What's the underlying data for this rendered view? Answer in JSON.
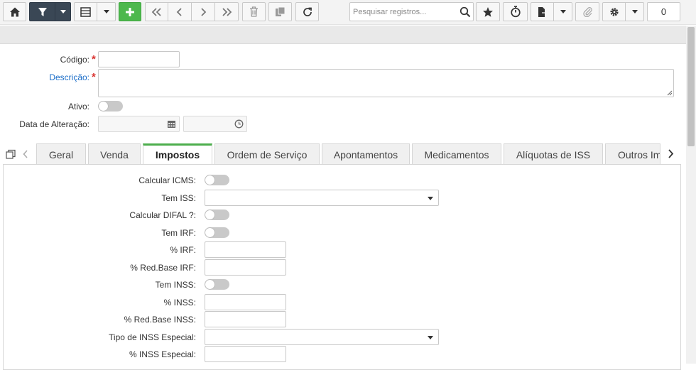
{
  "toolbar": {
    "search_placeholder": "Pesquisar registros...",
    "record_count": "0",
    "icons": [
      "home-icon",
      "filter-icon",
      "grid-icon",
      "add-icon",
      "first-icon",
      "prev-icon",
      "next-icon",
      "last-icon",
      "delete-icon",
      "copy-icon",
      "refresh-icon",
      "search-icon",
      "star-icon",
      "timer-icon",
      "export-icon",
      "attach-icon",
      "gear-icon"
    ]
  },
  "header_form": {
    "codigo_label": "Código:",
    "descricao_label": "Descrição:",
    "ativo_label": "Ativo:",
    "data_alteracao_label": "Data de Alteração:"
  },
  "tabs": [
    {
      "label": "Geral"
    },
    {
      "label": "Venda"
    },
    {
      "label": "Impostos"
    },
    {
      "label": "Ordem de Serviço"
    },
    {
      "label": "Apontamentos"
    },
    {
      "label": "Medicamentos"
    },
    {
      "label": "Alíquotas de ISS"
    },
    {
      "label": "Outros Im"
    }
  ],
  "impostos": {
    "calcular_icms": "Calcular ICMS:",
    "tem_iss": "Tem ISS:",
    "calcular_difal": "Calcular DIFAL ?:",
    "tem_irf": "Tem IRF:",
    "pct_irf": "% IRF:",
    "pct_red_base_irf": "% Red.Base IRF:",
    "tem_inss": "Tem INSS:",
    "pct_inss": "% INSS:",
    "pct_red_base_inss": "% Red.Base INSS:",
    "tipo_inss_especial": "Tipo de INSS Especial:",
    "pct_inss_especial": "% INSS Especial:"
  },
  "colors": {
    "accent_green": "#4cae4c",
    "required_red": "#d9322f",
    "link_blue": "#1a6dc8",
    "toolbar_dark": "#3a4755"
  }
}
